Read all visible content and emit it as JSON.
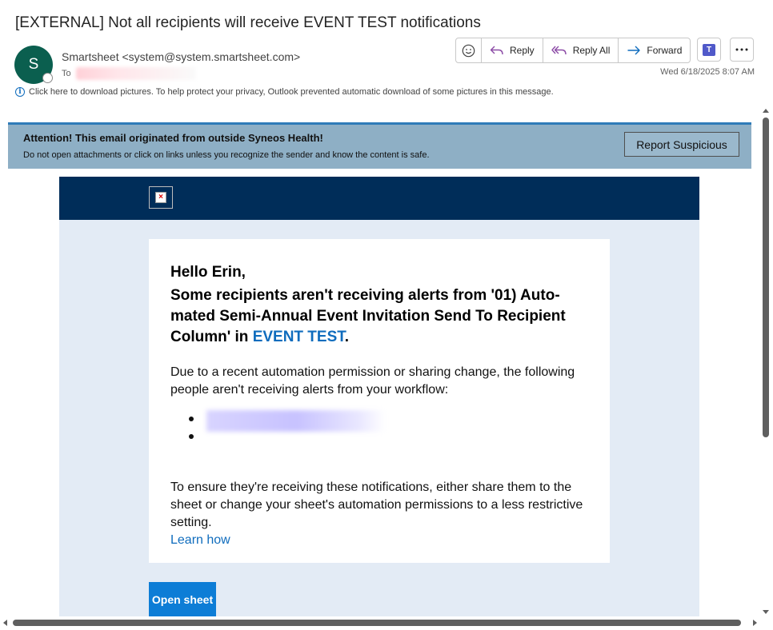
{
  "message": {
    "subject": "[EXTERNAL] Not all recipients will receive EVENT TEST notifications",
    "sender_initial": "S",
    "sender": "Smartsheet <system@system.smartsheet.com>",
    "to_label": "To",
    "date": "Wed 6/18/2025 8:07 AM",
    "privacy_notice": "Click here to download pictures. To help protect your privacy, Outlook prevented automatic download of some pictures in this message."
  },
  "toolbar": {
    "reply": "Reply",
    "reply_all": "Reply All",
    "forward": "Forward",
    "teams_letter": "T"
  },
  "banner": {
    "title": "Attention! This email originated from outside Syneos Health!",
    "text": "Do not open attachments or click on links unless you recognize the sender and know the content is safe.",
    "report_button": "Report Suspicious"
  },
  "email": {
    "greeting": "Hello Erin,",
    "heading_text": "Some recipients aren't receiving alerts from '01) Auto-mated Semi-Annual Event Invitation Send To Recipient Column' in ",
    "heading_link": "EVENT TEST",
    "heading_end": ".",
    "paragraph1": "Due to a recent automation permission or sharing change, the following people aren't receiving alerts from your workflow:",
    "paragraph2": "To ensure they're receiving these notifications, either share them to the sheet or change your sheet's automation permissions to a less restrictive setting.",
    "learn_how": "Learn how",
    "open_sheet": "Open sheet"
  },
  "colors": {
    "header_navy": "#002d59",
    "link_blue": "#0f6cbd",
    "button_blue": "#0d7dd6",
    "banner_bg": "#8eafc5",
    "avatar_green": "#0b5f4f"
  }
}
